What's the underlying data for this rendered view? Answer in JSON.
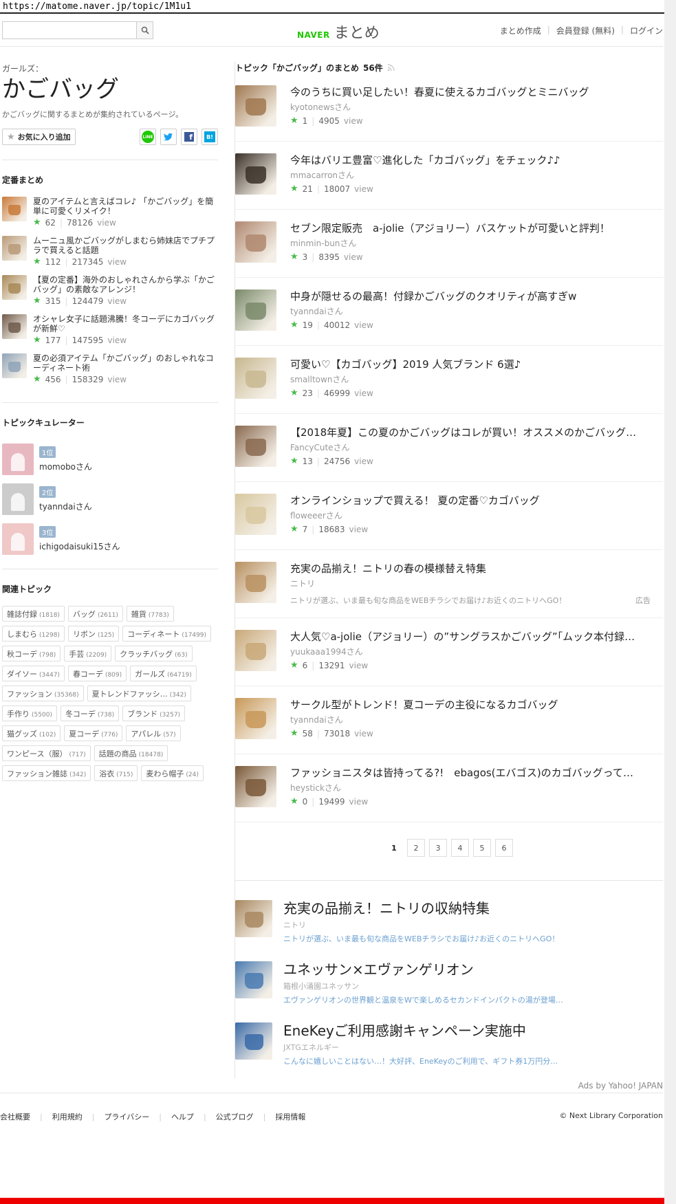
{
  "url": "https://matome.naver.jp/topic/1M1u1",
  "header": {
    "search_placeholder": "",
    "logo_naver": "NAVER",
    "logo_matome": "まとめ",
    "nav": [
      "まとめ作成",
      "会員登録 (無料)",
      "ログイン"
    ]
  },
  "topic": {
    "category": "ガールズ：",
    "title": "かごバッグ",
    "description": "かごバッグに関するまとめが集約されているページ。",
    "fav_label": "お気に入り追加",
    "share": [
      "LINE",
      "Twitter",
      "Facebook",
      "Hatena"
    ]
  },
  "standard": {
    "heading": "定番まとめ",
    "items": [
      {
        "title": "夏のアイテムと言えばコレ♪ 「かごバッグ」を簡単に可愛くリメイク！",
        "stars": "62",
        "views": "78126",
        "view_label": "view",
        "color": "#c97a3a"
      },
      {
        "title": "ムーニュ風かごバッグがしまむら姉妹店でプチプラで買えると話題",
        "stars": "112",
        "views": "217345",
        "view_label": "view",
        "color": "#b99a78"
      },
      {
        "title": "【夏の定番】海外のおしゃれさんから学ぶ「かごバッグ」の素敵なアレンジ！",
        "stars": "315",
        "views": "124479",
        "view_label": "view",
        "color": "#a88856"
      },
      {
        "title": "オシャレ女子に話題沸騰！冬コーデにカゴバッグが新鮮♡",
        "stars": "177",
        "views": "147595",
        "view_label": "view",
        "color": "#6f5a4a"
      },
      {
        "title": "夏の必須アイテム「かごバッグ」のおしゃれなコーディネート術",
        "stars": "456",
        "views": "158329",
        "view_label": "view",
        "color": "#8fa3b8"
      }
    ]
  },
  "curators": {
    "heading": "トピックキュレーター",
    "items": [
      {
        "rank": "1位",
        "name": "momoboさん",
        "color": "#e8b8c0"
      },
      {
        "rank": "2位",
        "name": "tyanndaiさん",
        "color": "#cccccc"
      },
      {
        "rank": "3位",
        "name": "ichigodaisuki15さん",
        "color": "#f0c8c8"
      }
    ]
  },
  "related": {
    "heading": "関連トピック",
    "tags": [
      {
        "name": "雑誌付録",
        "count": "(1818)"
      },
      {
        "name": "バッグ",
        "count": "(2611)"
      },
      {
        "name": "雑貨",
        "count": "(7783)"
      },
      {
        "name": "しまむら",
        "count": "(1298)"
      },
      {
        "name": "リボン",
        "count": "(125)"
      },
      {
        "name": "コーディネート",
        "count": "(17499)"
      },
      {
        "name": "秋コーデ",
        "count": "(798)"
      },
      {
        "name": "手芸",
        "count": "(2209)"
      },
      {
        "name": "クラッチバッグ",
        "count": "(63)"
      },
      {
        "name": "ダイソー",
        "count": "(3447)"
      },
      {
        "name": "春コーデ",
        "count": "(809)"
      },
      {
        "name": "ガールズ",
        "count": "(64719)"
      },
      {
        "name": "ファッション",
        "count": "(35368)"
      },
      {
        "name": "夏トレンドファッシ…",
        "count": "(342)"
      },
      {
        "name": "手作り",
        "count": "(5500)"
      },
      {
        "name": "冬コーデ",
        "count": "(738)"
      },
      {
        "name": "ブランド",
        "count": "(3257)"
      },
      {
        "name": "猫グッズ",
        "count": "(102)"
      },
      {
        "name": "夏コーデ",
        "count": "(776)"
      },
      {
        "name": "アパレル",
        "count": "(57)"
      },
      {
        "name": "ワンピース（服）",
        "count": "(717)"
      },
      {
        "name": "話題の商品",
        "count": "(18478)"
      },
      {
        "name": "ファッション雑誌",
        "count": "(342)"
      },
      {
        "name": "浴衣",
        "count": "(715)"
      },
      {
        "name": "麦わら帽子",
        "count": "(24)"
      }
    ]
  },
  "matome_list": {
    "heading": "トピック「かごバッグ」のまとめ",
    "count": "56件",
    "items": [
      {
        "title": "今のうちに買い足したい！春夏に使えるカゴバッグとミニバッグ",
        "author": "kyotonewsさん",
        "stars": "1",
        "views": "4905",
        "color": "#a07850"
      },
      {
        "title": "今年はバリエ豊富♡進化した「カゴバッグ」をチェック♪♪",
        "author": "mmacarronさん",
        "stars": "21",
        "views": "18007",
        "color": "#3a3028"
      },
      {
        "title": "セブン限定販売　a-jolie（アジョリー）バスケットが可愛いと評判！",
        "author": "minmin-bunさん",
        "stars": "3",
        "views": "8395",
        "color": "#b08870"
      },
      {
        "title": "中身が隠せるの最高！付録かごバッグのクオリティが高すぎw",
        "author": "tyanndaiさん",
        "stars": "19",
        "views": "40012",
        "color": "#7a8a6a"
      },
      {
        "title": "可愛い♡【カゴバッグ】2019 人気ブランド 6選♪",
        "author": "smalltownさん",
        "stars": "23",
        "views": "46999",
        "color": "#c8b890"
      },
      {
        "title": "【2018年夏】この夏のかごバッグはコレが買い！オススメのかごバッグ…",
        "author": "FancyCuteさん",
        "stars": "13",
        "views": "24756",
        "color": "#8a6a50"
      },
      {
        "title": "オンラインショップで買える！ 夏の定番♡カゴバッグ",
        "author": "floweeerさん",
        "stars": "7",
        "views": "18683",
        "color": "#d8c8a0"
      }
    ],
    "ad": {
      "title": "充実の品揃え！ニトリの春の模様替え特集",
      "source": "ニトリ",
      "desc": "ニトリが選ぶ、いま最も旬な商品をWEBチラシでお届け♪お近くのニトリへGO！",
      "label": "広告",
      "color": "#b89060"
    },
    "items2": [
      {
        "title": "大人気♡a-jolie（アジョリー）の”サングラスかごバッグ”「ムック本付録…",
        "author": "yuukaaa1994さん",
        "stars": "6",
        "views": "13291",
        "color": "#c8a878"
      },
      {
        "title": "サークル型がトレンド！夏コーデの主役になるカゴバッグ",
        "author": "tyanndaiさん",
        "stars": "58",
        "views": "73018",
        "color": "#c89858"
      },
      {
        "title": "ファッショニスタは皆持ってる?!　ebagos(エバゴス)のカゴバッグって一…",
        "author": "heystickさん",
        "stars": "0",
        "views": "19499",
        "color": "#7a5838"
      }
    ],
    "view_label": "view"
  },
  "pager": [
    "1",
    "2",
    "3",
    "4",
    "5",
    "6"
  ],
  "ads": [
    {
      "title": "充実の品揃え！ニトリの収納特集",
      "source": "ニトリ",
      "desc": "ニトリが選ぶ、いま最も旬な商品をWEBチラシでお届け♪お近くのニトリへGO！",
      "color": "#a88860"
    },
    {
      "title": "ユネッサン×エヴァンゲリオン",
      "source": "箱根小涌園ユネッサン",
      "desc": "エヴァンゲリオンの世界観と温泉をWで楽しめるセカンドインパクトの湯が登場！ …",
      "color": "#4a7ab0"
    },
    {
      "title": "EneKeyご利用感謝キャンペーン実施中",
      "source": "JXTGエネルギー",
      "desc": "こんなに嬉しいことはない…！大好評、EneKeyのご利用で、ギフト券1万円分…",
      "color": "#3a6aa8"
    }
  ],
  "ads_by": "Ads by Yahoo! JAPAN",
  "footer": {
    "links": [
      "会社概要",
      "利用規約",
      "プライバシー",
      "ヘルプ",
      "公式ブログ",
      "採用情報"
    ],
    "copyright": "© Next Library Corporation"
  }
}
